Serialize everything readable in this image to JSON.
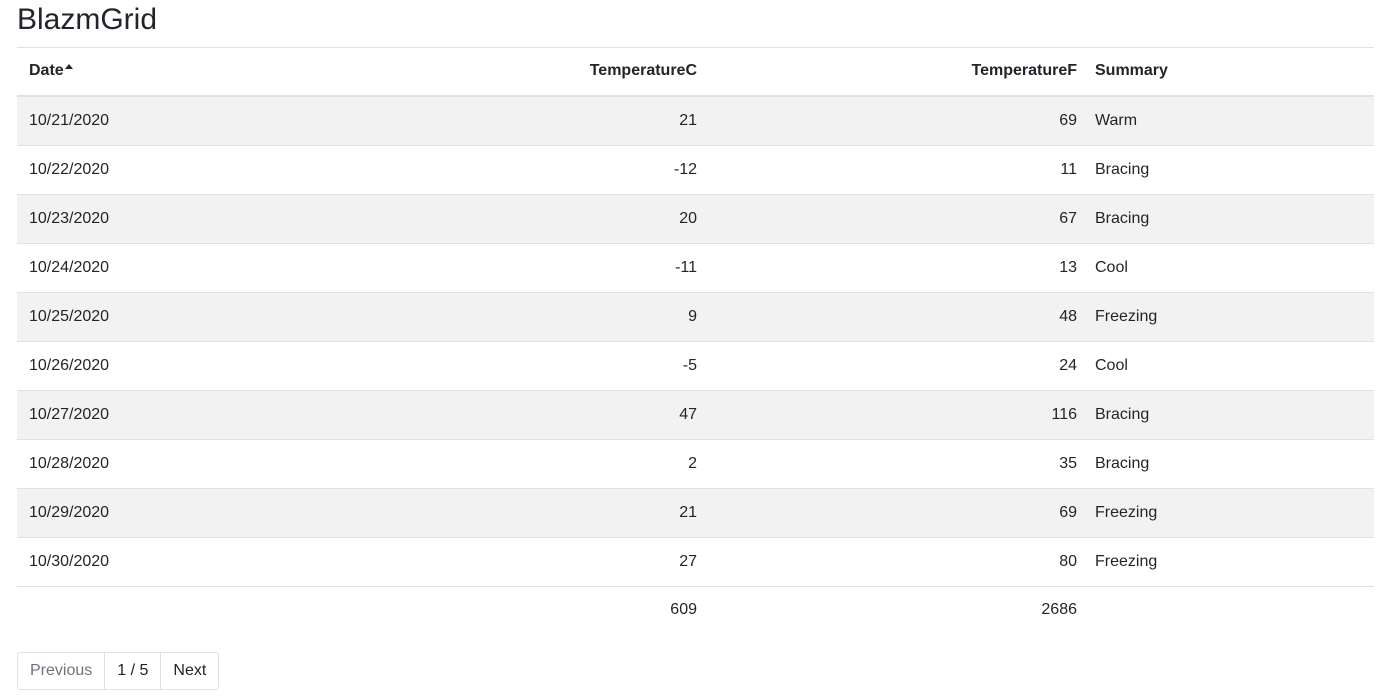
{
  "page": {
    "title": "BlazmGrid"
  },
  "grid": {
    "columns": {
      "date": "Date",
      "temperature_c": "TemperatureC",
      "temperature_f": "TemperatureF",
      "summary": "Summary"
    },
    "sort": {
      "column": "Date",
      "direction": "ascending",
      "icon": "sort-ascending-icon"
    },
    "colors": {
      "positive_temp": "#0000cc",
      "negative_temp": "#aa1a1a",
      "striped_row": "#f2f2f2"
    },
    "rows": [
      {
        "date": "10/21/2020",
        "temperature_c": "21",
        "temperature_f": "69",
        "summary": "Warm"
      },
      {
        "date": "10/22/2020",
        "temperature_c": "-12",
        "temperature_f": "11",
        "summary": "Bracing"
      },
      {
        "date": "10/23/2020",
        "temperature_c": "20",
        "temperature_f": "67",
        "summary": "Bracing"
      },
      {
        "date": "10/24/2020",
        "temperature_c": "-11",
        "temperature_f": "13",
        "summary": "Cool"
      },
      {
        "date": "10/25/2020",
        "temperature_c": "9",
        "temperature_f": "48",
        "summary": "Freezing"
      },
      {
        "date": "10/26/2020",
        "temperature_c": "-5",
        "temperature_f": "24",
        "summary": "Cool"
      },
      {
        "date": "10/27/2020",
        "temperature_c": "47",
        "temperature_f": "116",
        "summary": "Bracing"
      },
      {
        "date": "10/28/2020",
        "temperature_c": "2",
        "temperature_f": "35",
        "summary": "Bracing"
      },
      {
        "date": "10/29/2020",
        "temperature_c": "21",
        "temperature_f": "69",
        "summary": "Freezing"
      },
      {
        "date": "10/30/2020",
        "temperature_c": "27",
        "temperature_f": "80",
        "summary": "Freezing"
      }
    ],
    "totals": {
      "temperature_c": "609",
      "temperature_f": "2686"
    }
  },
  "pager": {
    "previous_label": "Previous",
    "page_info": "1 / 5",
    "next_label": "Next"
  }
}
